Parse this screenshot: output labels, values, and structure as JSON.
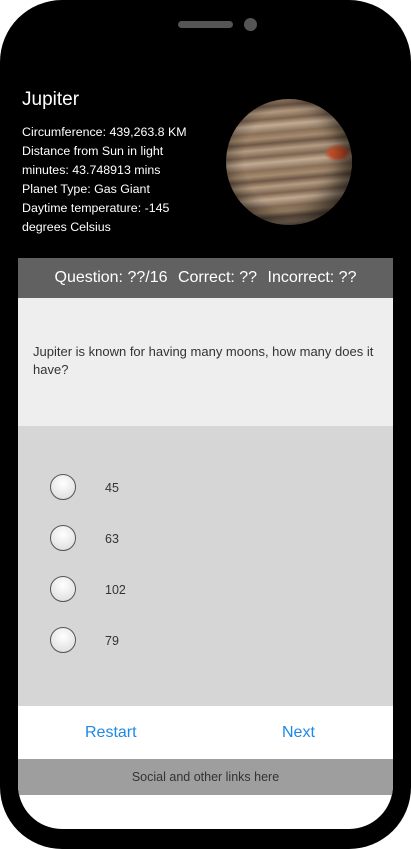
{
  "planet": {
    "name": "Jupiter",
    "facts": [
      "Circumference: 439,263.8 KM",
      "Distance from Sun in light minutes: 43.748913 mins",
      "Planet Type: Gas Giant",
      "Daytime temperature: -145 degrees Celsius"
    ]
  },
  "score": {
    "question": "Question: ??/16",
    "correct": "Correct: ??",
    "incorrect": "Incorrect: ??"
  },
  "question": {
    "text": "Jupiter is known for having many moons, how many does it have?"
  },
  "answers": [
    "45",
    "63",
    "102",
    "79"
  ],
  "navigation": {
    "restart_label": "Restart",
    "next_label": "Next"
  },
  "footer": {
    "text": "Social and other links here"
  },
  "colors": {
    "accent": "#1e88e5",
    "score_bar": "#616161",
    "question_bg": "#eeeeee",
    "answers_bg": "#d6d6d6",
    "footer_bg": "#9e9e9e"
  }
}
